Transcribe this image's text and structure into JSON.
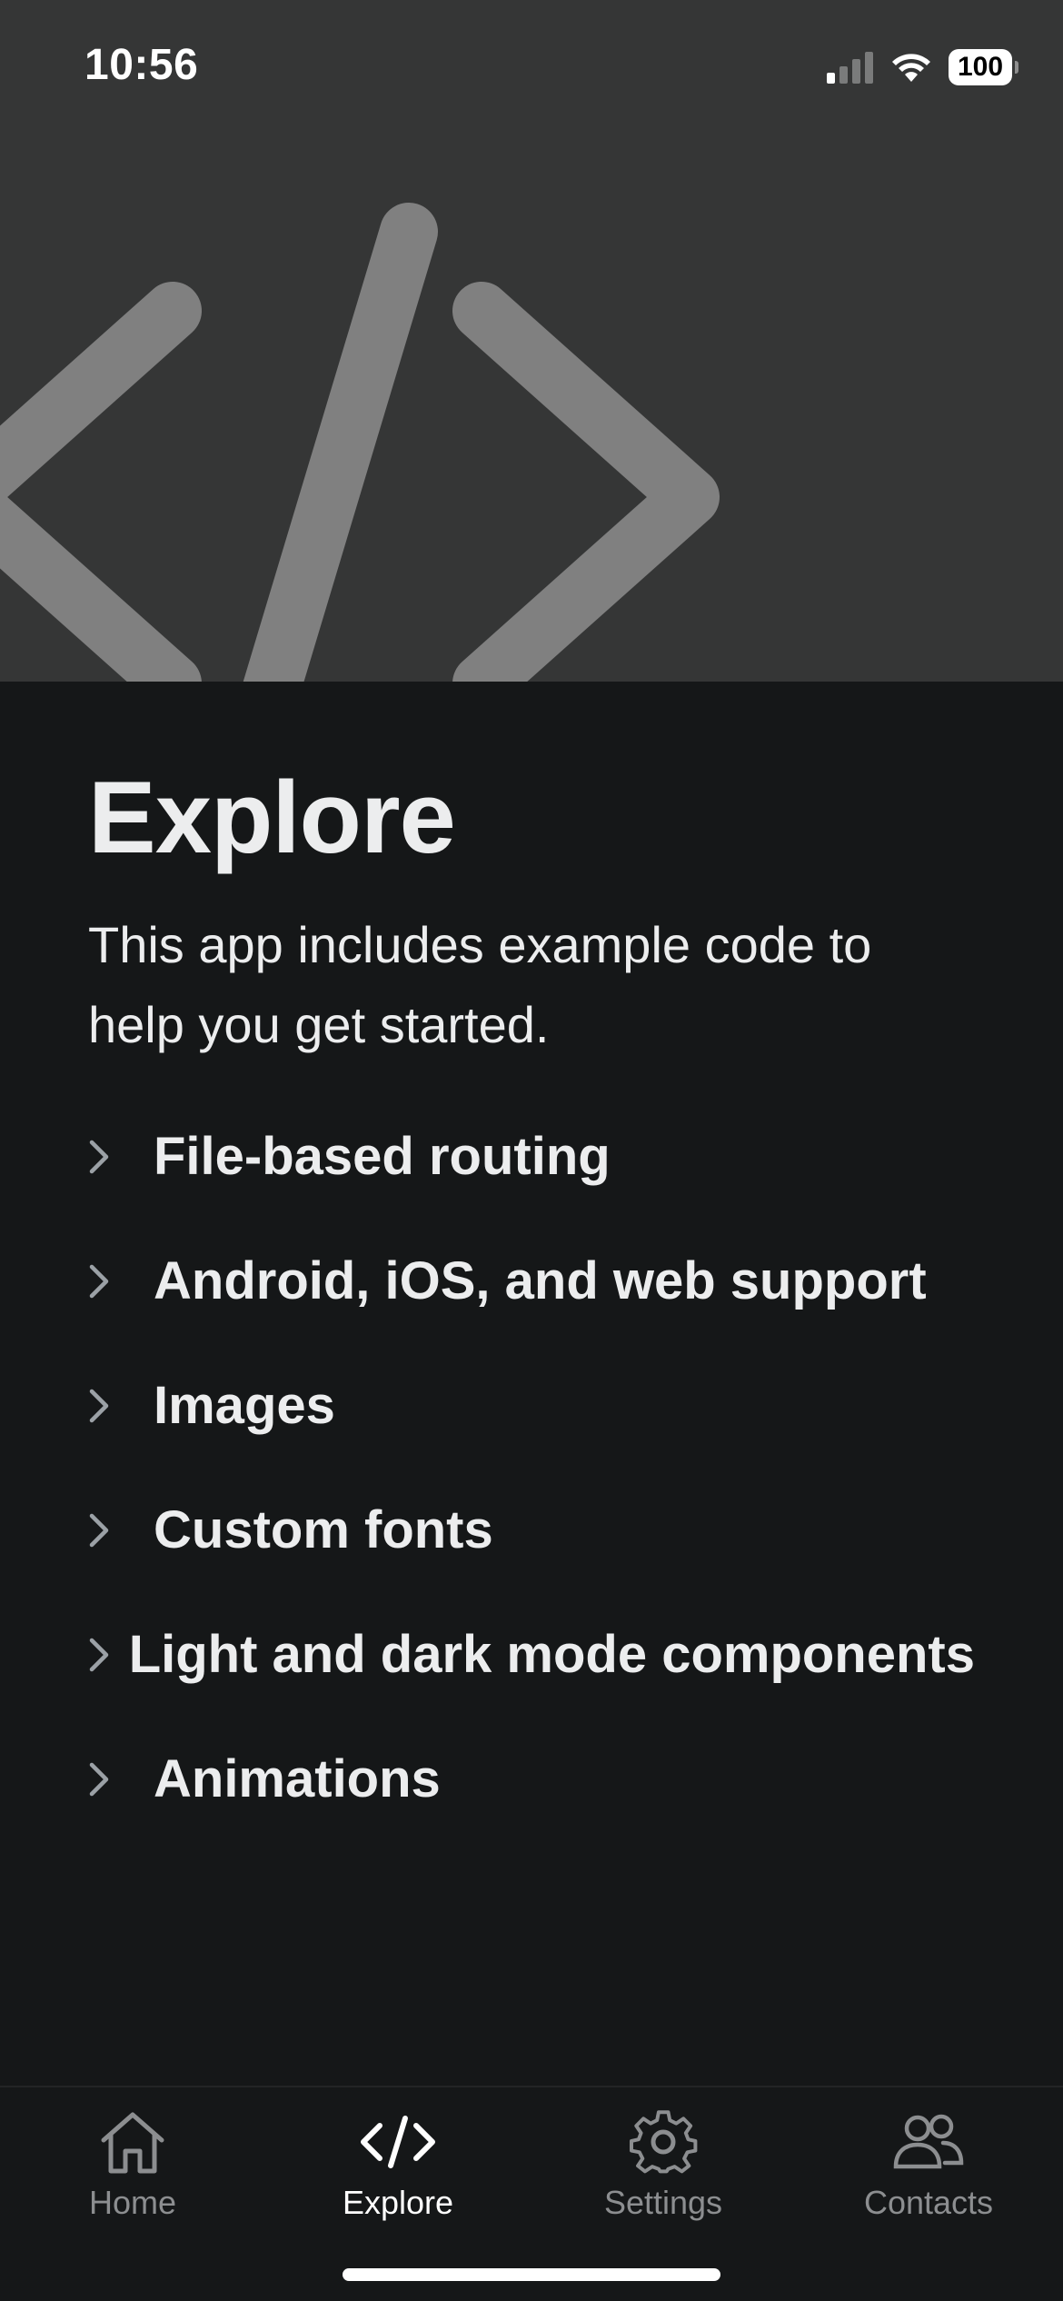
{
  "status_bar": {
    "time": "10:56",
    "battery": "100"
  },
  "header": {
    "icon": "code-slash-icon",
    "background": "#353636",
    "icon_color": "#808080"
  },
  "main": {
    "title": "Explore",
    "intro": "This app includes example code to help you get started.",
    "items": [
      {
        "label": "File-based routing"
      },
      {
        "label": "Android, iOS, and web support"
      },
      {
        "label": "Images"
      },
      {
        "label": "Custom fonts"
      },
      {
        "label": "Light and dark mode components"
      },
      {
        "label": "Animations"
      }
    ]
  },
  "tabbar": {
    "tabs": [
      {
        "label": "Home",
        "icon": "house-icon",
        "active": false
      },
      {
        "label": "Explore",
        "icon": "code-icon",
        "active": true
      },
      {
        "label": "Settings",
        "icon": "gear-icon",
        "active": false
      },
      {
        "label": "Contacts",
        "icon": "people-icon",
        "active": false
      }
    ]
  },
  "colors": {
    "background": "#151718",
    "text": "#ECEDEE",
    "tab_inactive": "#8C8E90",
    "tab_active": "#FFFFFF"
  }
}
